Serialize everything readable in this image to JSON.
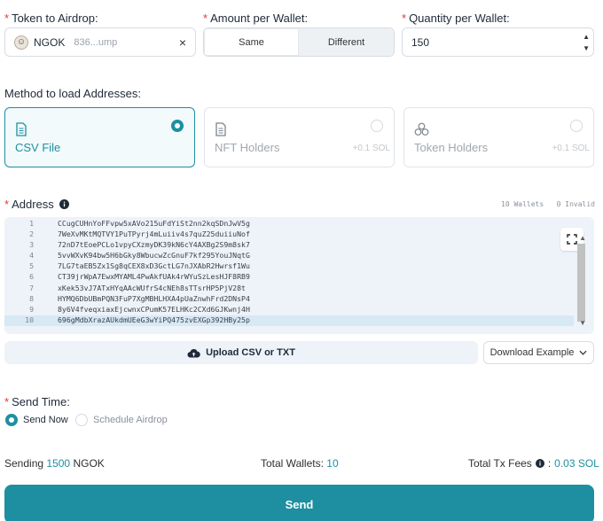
{
  "token": {
    "label": "Token to Airdrop:",
    "symbol": "NGOK",
    "address": "836...ump",
    "clear": "×"
  },
  "amount": {
    "label": "Amount per Wallet:",
    "options": [
      "Same",
      "Different"
    ],
    "selected": "Same"
  },
  "quantity": {
    "label": "Quantity per Wallet:",
    "value": "150"
  },
  "method": {
    "label": "Method to load Addresses:",
    "cards": [
      {
        "title": "CSV File",
        "fee": "",
        "selected": true
      },
      {
        "title": "NFT Holders",
        "fee": "+0.1 SOL",
        "selected": false
      },
      {
        "title": "Token Holders",
        "fee": "+0.1 SOL",
        "selected": false
      }
    ]
  },
  "address": {
    "label": "Address",
    "wallets_count": "10 Wallets",
    "invalid_count": "0 Invalid",
    "lines": [
      {
        "n": "1",
        "text": "CCugCUHnYoFFvpw5xAVo215uFdYiSt2nn2kqSDnJwV5g"
      },
      {
        "n": "2",
        "text": "7WeXvMKtMQTVY1PuTPyrj4mLuiiv4s7quZ25duiiuNof"
      },
      {
        "n": "3",
        "text": "72nD7tEoePCLo1vpyCXzmyDK39kN6cY4AXBg2S9m8sk7"
      },
      {
        "n": "4",
        "text": "5vvWXvK94bw5H6bGky8WbucwZcGnuF7kf295YouJNqtG"
      },
      {
        "n": "5",
        "text": "7LG7taEB5Zx1Sg8qCEX8xD3GctLG7nJXAbR2Hwrsf1Wu"
      },
      {
        "n": "6",
        "text": "CT39jrWpA7EwxMYAML4PwAkfUAk4rWYuSzLesHJF8RB9"
      },
      {
        "n": "7",
        "text": "xKek53vJ7ATxHYqAAcWUfrS4cNEh8sTTsrHP5PjV28t"
      },
      {
        "n": "8",
        "text": "HYMQ6DbUBmPQN3FuP7XgMBHLHXA4pUaZnwhFrd2DNsP4"
      },
      {
        "n": "9",
        "text": "8y6V4fveqxiaxEjcwnxCPumK57ELHKc2CXd6GJKwnj4H"
      },
      {
        "n": "10",
        "text": "696gMdbXrazAUkdmUEeG3wYiPQ475zvEXGp392HBy25p"
      }
    ]
  },
  "upload": {
    "label": "Upload CSV or TXT"
  },
  "download": {
    "label": "Download Example"
  },
  "send_time": {
    "label": "Send Time:",
    "options": [
      {
        "label": "Send Now",
        "selected": true
      },
      {
        "label": "Schedule Airdrop",
        "selected": false
      }
    ]
  },
  "summary": {
    "sending_prefix": "Sending",
    "sending_amount": "1500",
    "sending_token": "NGOK",
    "wallets_label": "Total Wallets:",
    "wallets_value": "10",
    "fees_label": "Total Tx Fees",
    "fees_sep": ":",
    "fees_value": "0.03 SOL"
  },
  "send_button": {
    "label": "Send"
  },
  "colors": {
    "accent": "#1e8fa0",
    "required": "#e53935"
  }
}
